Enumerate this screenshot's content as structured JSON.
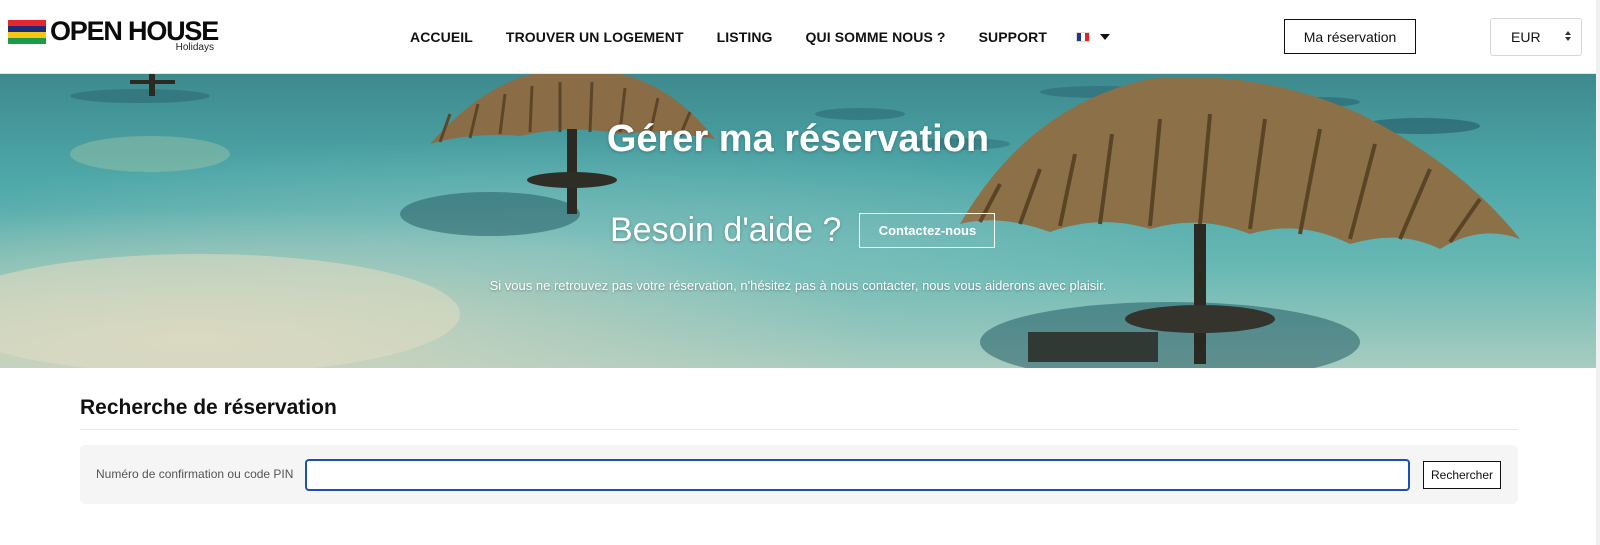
{
  "header": {
    "logo": {
      "name": "OPEN HOUSE",
      "tagline": "Holidays",
      "flag_colors": [
        "#e6262d",
        "#1a2c7a",
        "#f5c518",
        "#1c9a4a"
      ]
    },
    "nav": [
      {
        "label": "ACCUEIL"
      },
      {
        "label": "TROUVER UN LOGEMENT"
      },
      {
        "label": "LISTING"
      },
      {
        "label": "QUI SOMME NOUS ?"
      },
      {
        "label": "SUPPORT"
      }
    ],
    "language": {
      "icon": "france-flag-icon",
      "flag_colors": [
        "#1e3a8a",
        "#ffffff",
        "#dc2626"
      ]
    },
    "reservation_button": "Ma réservation",
    "currency": {
      "selected": "EUR"
    }
  },
  "hero": {
    "title": "Gérer ma réservation",
    "help_text": "Besoin d'aide ?",
    "contact_button": "Contactez-nous",
    "subtitle": "Si vous ne retrouvez pas votre réservation, n'hésitez pas à nous contacter, nous vous aiderons avec plaisir."
  },
  "search": {
    "section_title": "Recherche de réservation",
    "field_label": "Numéro de confirmation ou code PIN",
    "input_value": "",
    "button_label": "Rechercher"
  },
  "colors": {
    "input_focus_border": "#1f4fb4",
    "search_panel_bg": "#f5f5f5"
  }
}
